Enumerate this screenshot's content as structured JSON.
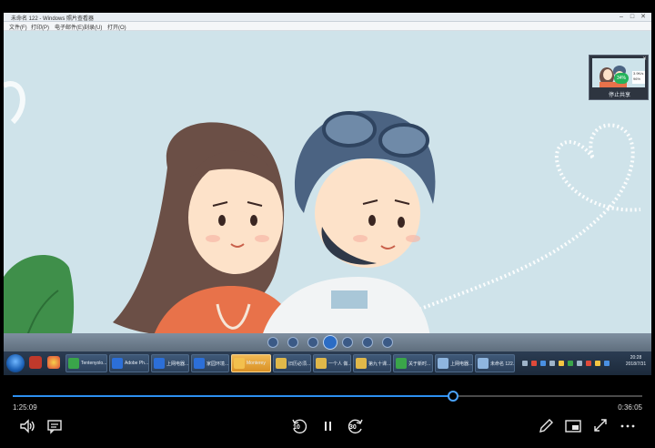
{
  "inner_window": {
    "title": "未命名 122 - Windows 照片查看器",
    "menu": [
      "文件(F)",
      "打印(P)",
      "电子邮件(E)",
      "刻录(U)",
      "打开(O)"
    ]
  },
  "preview_thumbnail": {
    "badge": "34%",
    "stats": [
      "3.9K/s",
      "96%"
    ],
    "label": "停止共享"
  },
  "inner_taskbar": {
    "items": [
      {
        "label": "Tentenyolo...",
        "color": "#3aa54a"
      },
      {
        "label": "Adobe Ph...",
        "color": "#2c6fd8"
      },
      {
        "label": "上网电器...",
        "color": "#2c6fd8"
      },
      {
        "label": "家园环境...",
        "color": "#2c6fd8"
      },
      {
        "label": "Monterey",
        "color": "#f3c04d",
        "active": true
      },
      {
        "label": "旧历必须...",
        "color": "#e0b84a"
      },
      {
        "label": "一个人 做...",
        "color": "#e0b84a"
      },
      {
        "label": "第九十课...",
        "color": "#e0b84a"
      },
      {
        "label": "关于新时...",
        "color": "#3aa54a"
      },
      {
        "label": "上网电器...",
        "color": "#8fb6e0"
      },
      {
        "label": "未命名 122...",
        "color": "#8fb6e0"
      }
    ],
    "clock_time": "20:28",
    "clock_date": "2018/7/31"
  },
  "player": {
    "time_current": "1:25:09",
    "time_remaining": "0:36:05",
    "progress": 0.7,
    "skip_back_seconds": "10",
    "skip_forward_seconds": "30"
  },
  "colors": {
    "accent": "#2d8ff0",
    "sky": "#cfe3ea"
  },
  "icons": [
    "volume-icon",
    "subtitles-icon",
    "skip-back-icon",
    "pause-icon",
    "skip-forward-icon",
    "edit-icon",
    "mini-view-icon",
    "fullscreen-icon",
    "more-icon"
  ]
}
